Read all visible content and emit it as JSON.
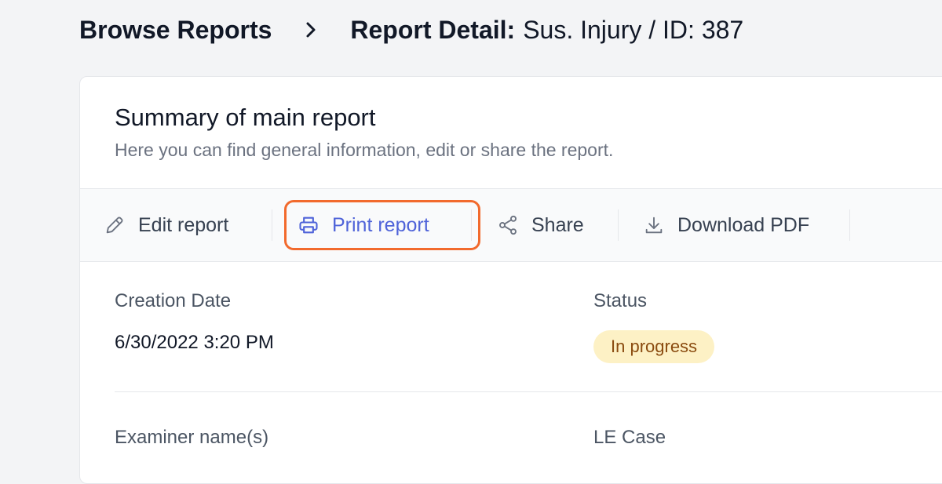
{
  "breadcrumb": {
    "parent": "Browse Reports",
    "separator_icon": "chevron-right-icon",
    "current_label": "Report Detail:",
    "current_value": "Sus. Injury / ID: 387"
  },
  "card": {
    "title": "Summary of main report",
    "subtitle": "Here you can find general information, edit or share the report."
  },
  "toolbar": {
    "edit_label": "Edit report",
    "print_label": "Print report",
    "share_label": "Share",
    "download_label": "Download PDF",
    "highlight_color": "#f26a2d",
    "accent_color": "#4f63d9"
  },
  "fields": {
    "creation_date_label": "Creation Date",
    "creation_date_value": "6/30/2022 3:20 PM",
    "status_label": "Status",
    "status_value": "In progress",
    "examiner_label": "Examiner name(s)",
    "le_case_label": "LE Case"
  }
}
